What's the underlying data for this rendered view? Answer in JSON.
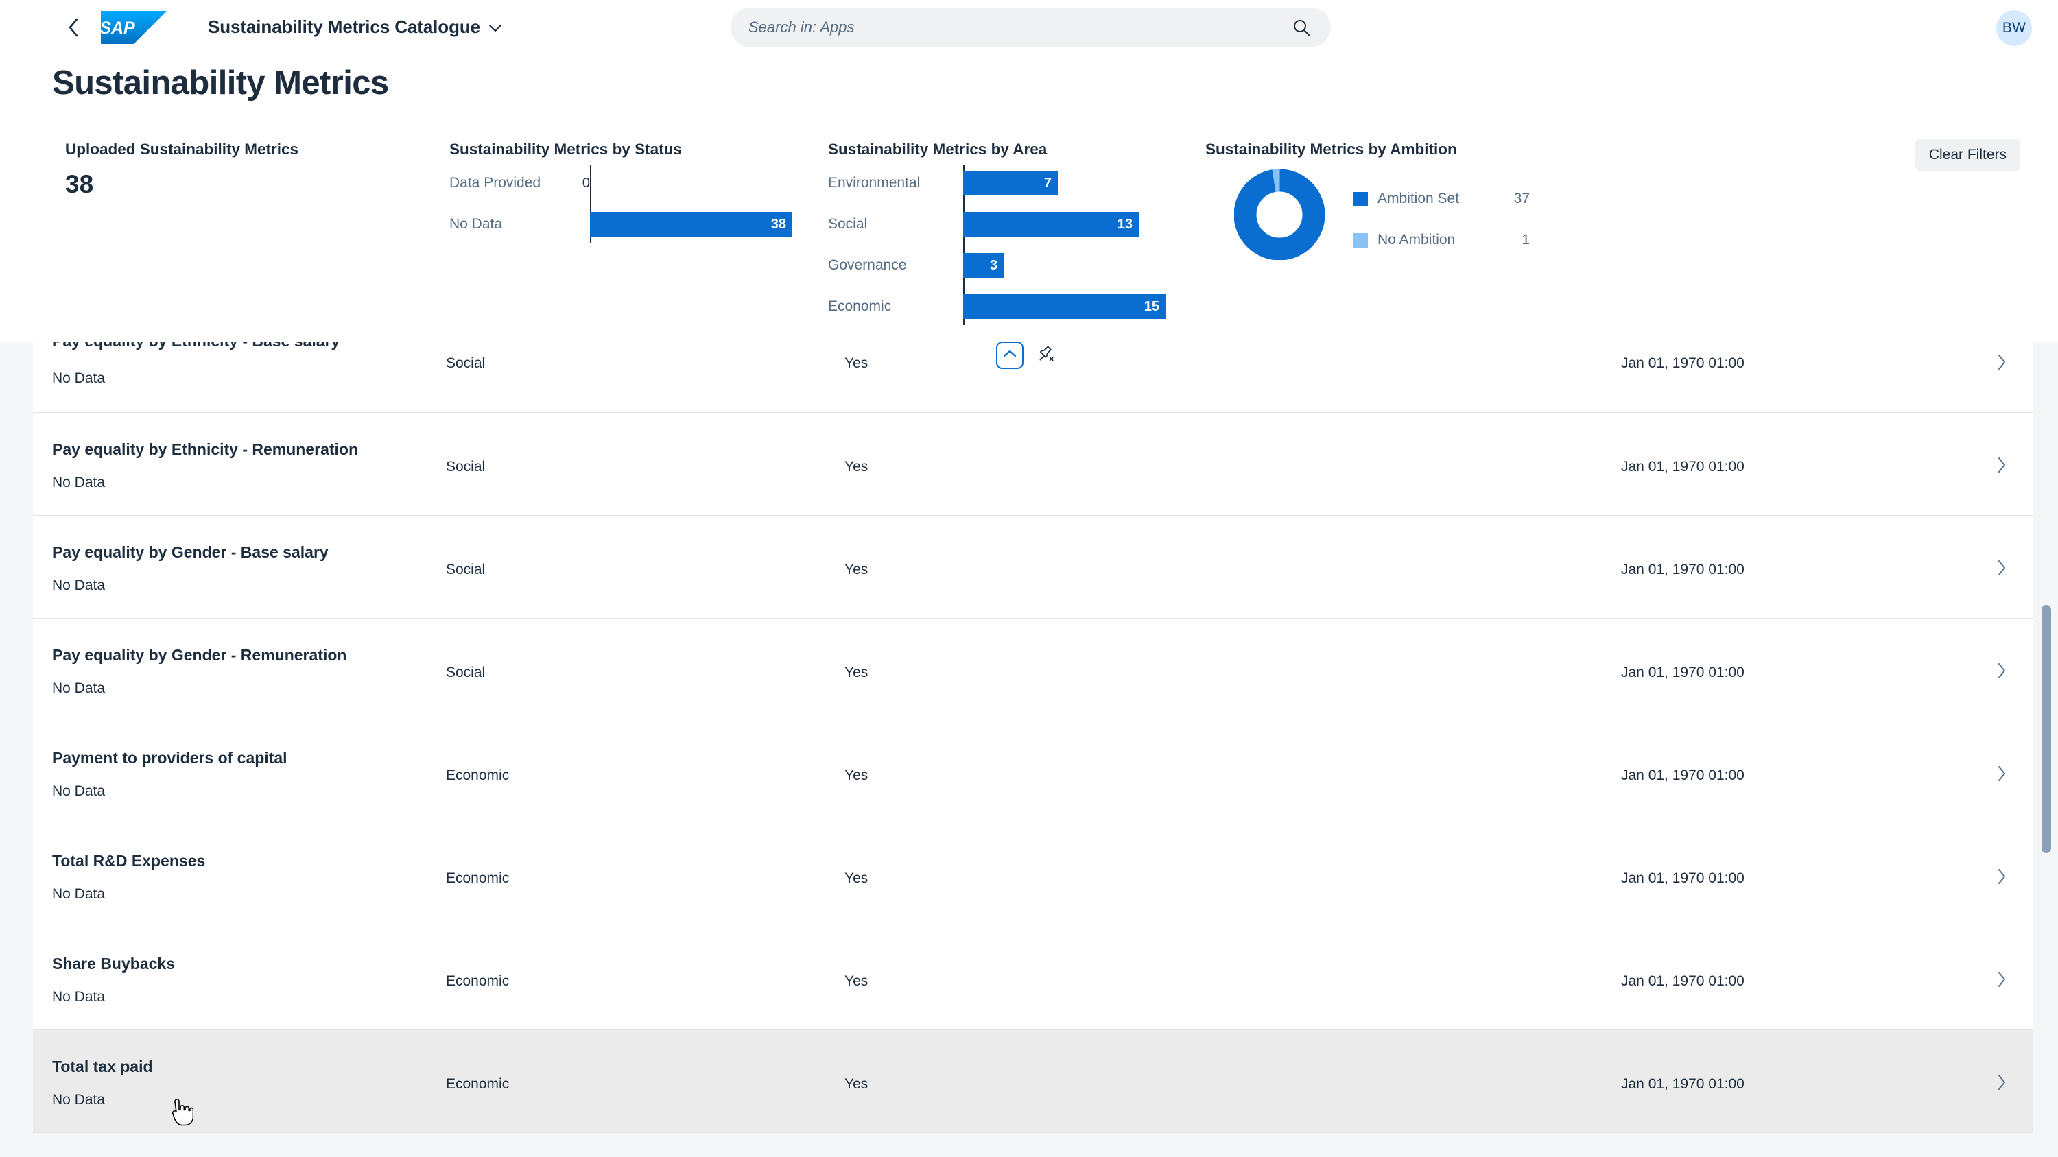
{
  "shell": {
    "back_icon": "chevron-left-icon",
    "logo": "sap-logo",
    "logo_text": "SAP",
    "app_title": "Sustainability Metrics Catalogue",
    "app_title_chevron": "chevron-down-icon",
    "search": {
      "placeholder": "Search in: Apps",
      "value": "",
      "icon": "search-icon"
    },
    "avatar": {
      "initials": "BW"
    }
  },
  "page": {
    "title": "Sustainability Metrics"
  },
  "filter_bar": {
    "clear_filters_label": "Clear Filters",
    "collapse_icon": "chevron-up-icon",
    "unpin_icon": "unpin-icon"
  },
  "kpi": {
    "title": "Uploaded Sustainability Metrics",
    "value": "38"
  },
  "chart_data": [
    {
      "type": "bar",
      "orientation": "horizontal",
      "title": "Sustainability Metrics by Status",
      "categories": [
        "Data Provided",
        "No Data"
      ],
      "values": [
        0,
        38
      ],
      "xlabel": "",
      "ylabel": "",
      "xlim": [
        0,
        38
      ],
      "grid": false,
      "legend": "none",
      "colors": {
        "bar": "#0a6ed1"
      },
      "data_labels": [
        "0",
        "38"
      ]
    },
    {
      "type": "bar",
      "orientation": "horizontal",
      "title": "Sustainability Metrics by Area",
      "categories": [
        "Environmental",
        "Social",
        "Governance",
        "Economic"
      ],
      "values": [
        7,
        13,
        3,
        15
      ],
      "xlabel": "",
      "ylabel": "",
      "xlim": [
        0,
        15
      ],
      "grid": false,
      "legend": "none",
      "colors": {
        "bar": "#0a6ed1"
      },
      "data_labels": [
        "7",
        "13",
        "3",
        "15"
      ]
    },
    {
      "type": "pie",
      "variant": "donut",
      "title": "Sustainability Metrics by Ambition",
      "categories": [
        "Ambition Set",
        "No Ambition"
      ],
      "values": [
        37,
        1
      ],
      "legend": "right",
      "colors": {
        "Ambition Set": "#0a6ed1",
        "No Ambition": "#89c3f5"
      }
    }
  ],
  "table": {
    "rows": [
      {
        "name": "Pay equality by Ethnicity - Base salary",
        "status": "No Data",
        "area": "Social",
        "ambition": "Yes",
        "date": "Jan 01, 1970 01:00",
        "nav_icon": "chevron-right-icon",
        "clipped": true,
        "hovered": false
      },
      {
        "name": "Pay equality by Ethnicity - Remuneration",
        "status": "No Data",
        "area": "Social",
        "ambition": "Yes",
        "date": "Jan 01, 1970 01:00",
        "nav_icon": "chevron-right-icon",
        "clipped": false,
        "hovered": false
      },
      {
        "name": "Pay equality by Gender - Base salary",
        "status": "No Data",
        "area": "Social",
        "ambition": "Yes",
        "date": "Jan 01, 1970 01:00",
        "nav_icon": "chevron-right-icon",
        "clipped": false,
        "hovered": false
      },
      {
        "name": "Pay equality by Gender - Remuneration",
        "status": "No Data",
        "area": "Social",
        "ambition": "Yes",
        "date": "Jan 01, 1970 01:00",
        "nav_icon": "chevron-right-icon",
        "clipped": false,
        "hovered": false
      },
      {
        "name": "Payment to providers of capital",
        "status": "No Data",
        "area": "Economic",
        "ambition": "Yes",
        "date": "Jan 01, 1970 01:00",
        "nav_icon": "chevron-right-icon",
        "clipped": false,
        "hovered": false
      },
      {
        "name": "Total R&D Expenses",
        "status": "No Data",
        "area": "Economic",
        "ambition": "Yes",
        "date": "Jan 01, 1970 01:00",
        "nav_icon": "chevron-right-icon",
        "clipped": false,
        "hovered": false
      },
      {
        "name": "Share Buybacks",
        "status": "No Data",
        "area": "Economic",
        "ambition": "Yes",
        "date": "Jan 01, 1970 01:00",
        "nav_icon": "chevron-right-icon",
        "clipped": false,
        "hovered": false
      },
      {
        "name": "Total tax paid",
        "status": "No Data",
        "area": "Economic",
        "ambition": "Yes",
        "date": "Jan 01, 1970 01:00",
        "nav_icon": "chevron-right-icon",
        "clipped": false,
        "hovered": true
      }
    ]
  },
  "theme": {
    "accent": "#0a6ed1",
    "accent_light": "#89c3f5",
    "text": "#1d2d3e",
    "text_muted": "#556b82",
    "bg": "#ffffff",
    "bg_alt": "#f5f6f7",
    "row_hover": "#ebebeb"
  }
}
